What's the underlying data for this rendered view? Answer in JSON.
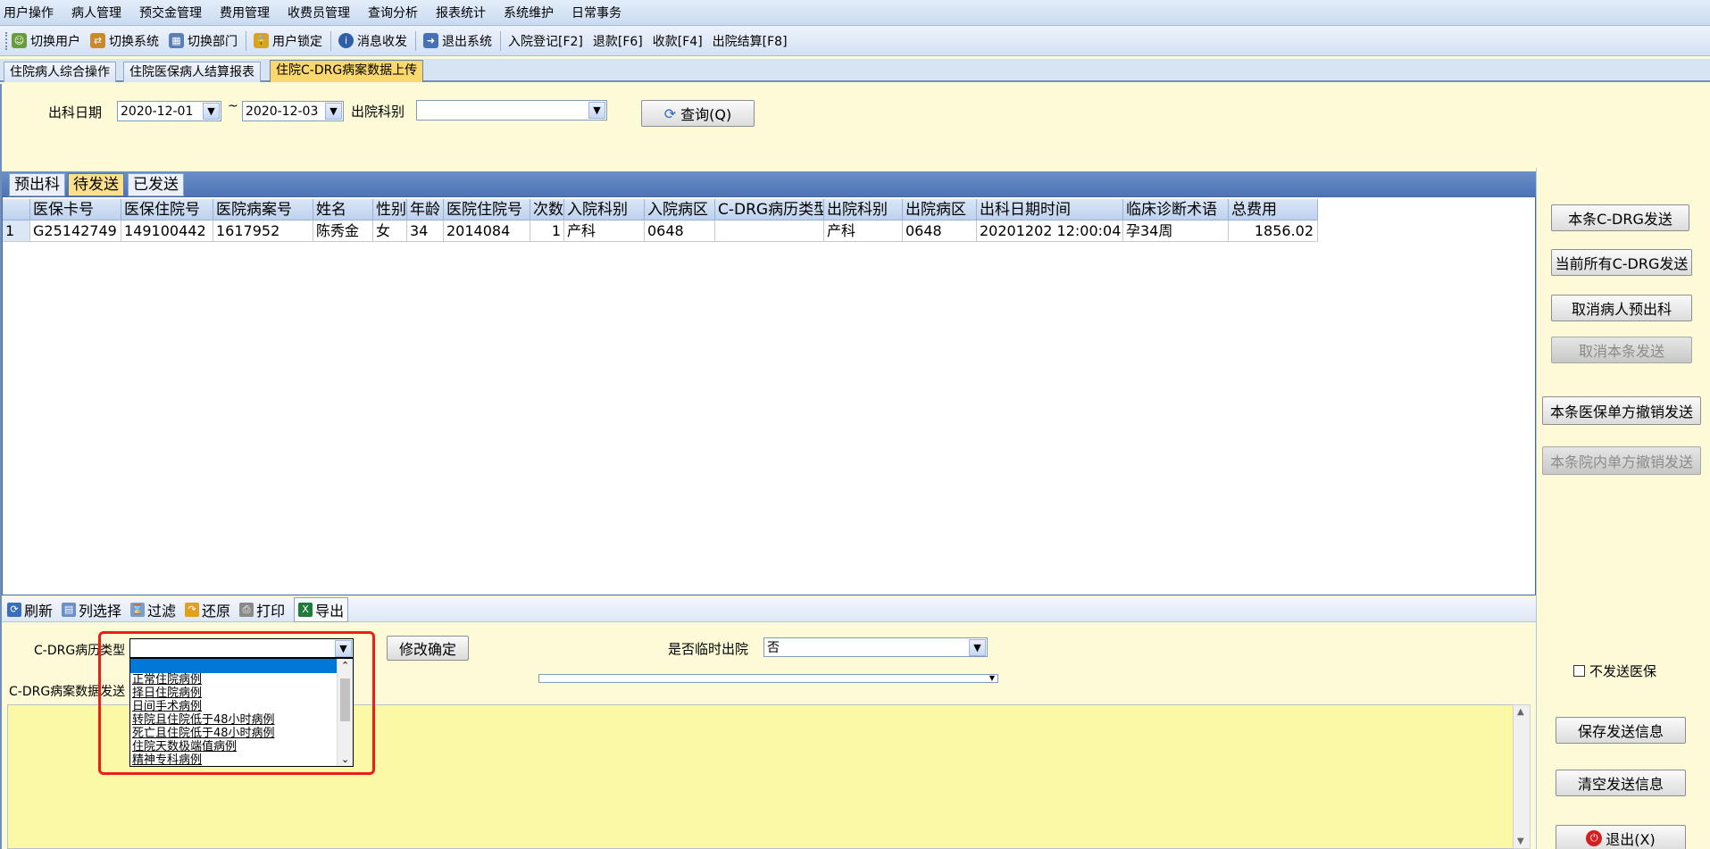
{
  "menu": [
    "用户操作",
    "病人管理",
    "预交金管理",
    "费用管理",
    "收费员管理",
    "查询分析",
    "报表统计",
    "系统维护",
    "日常事务"
  ],
  "toolbar": {
    "switch_user": "切换用户",
    "switch_system": "切换系统",
    "switch_dept": "切换部门",
    "user_lock": "用户锁定",
    "message": "消息收发",
    "exit_system": "退出系统",
    "admit": "入院登记[F2]",
    "refund": "退款[F6]",
    "collect": "收款[F4]",
    "discharge": "出院结算[F8]"
  },
  "tabs": [
    "住院病人综合操作",
    "住院医保病人结算报表",
    "住院C-DRG病案数据上传"
  ],
  "filter": {
    "date_label": "出科日期",
    "date_from": "2020-12-01",
    "separator": "~",
    "date_to": "2020-12-03",
    "dept_label": "出院科别",
    "dept_value": "",
    "query_button": "查询(Q)"
  },
  "subtabs": [
    "预出科",
    "待发送",
    "已发送"
  ],
  "grid": {
    "columns": [
      "医保卡号",
      "医保住院号",
      "医院病案号",
      "姓名",
      "性别",
      "年龄",
      "医院住院号",
      "次数",
      "入院科别",
      "入院病区",
      "C-DRG病历类型",
      "出院科别",
      "出院病区",
      "出科日期时间",
      "临床诊断术语",
      "总费用"
    ],
    "rows": [
      [
        "1",
        "G25142749",
        "149100442",
        "1617952",
        "陈秀金",
        "女",
        "34",
        "2014084",
        "1",
        "产科",
        "0648",
        "",
        "产科",
        "0648",
        "20201202 12:00:04",
        "孕34周",
        "1856.02"
      ]
    ]
  },
  "grid_tools": {
    "refresh": "刷新",
    "columns": "列选择",
    "filter": "过滤",
    "restore": "还原",
    "print": "打印",
    "export": "导出"
  },
  "edit": {
    "type_label": "C-DRG病历类型",
    "type_value": "",
    "confirm_button": "修改确定",
    "temp_discharge_label": "是否临时出院",
    "temp_discharge_value": "否",
    "send_info_label": "C-DRG病案数据发送"
  },
  "dropdown_options": [
    "正常住院病例",
    "择日住院病例",
    "日间手术病例",
    "转院且住院低于48小时病例",
    "死亡且住院低于48小时病例",
    "住院天数极端值病例",
    "精神专科病例"
  ],
  "right_buttons": {
    "send_this": "本条C-DRG发送",
    "send_all": "当前所有C-DRG发送",
    "cancel_pre": "取消病人预出科",
    "cancel_send": "取消本条发送",
    "ins_cancel": "本条医保单方撤销发送",
    "hosp_cancel": "本条院内单方撤销发送",
    "no_send": "不发送医保",
    "save": "保存发送信息",
    "clear": "清空发送信息",
    "exit": "退出(X)"
  }
}
